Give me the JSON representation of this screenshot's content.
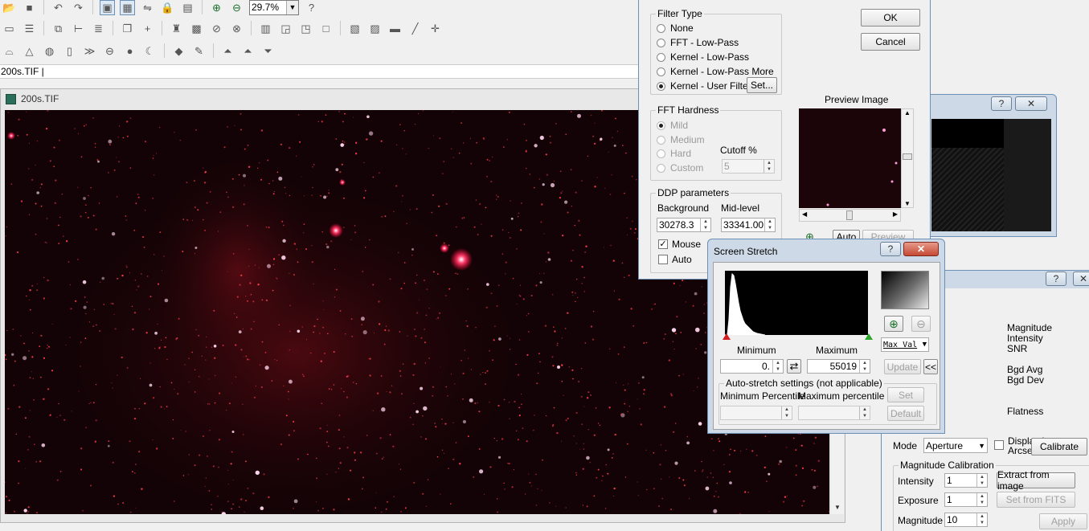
{
  "toolbar": {
    "zoom_value": "29.7%",
    "row1_icons": [
      "folder-open-icon",
      "save-icon",
      "undo-icon",
      "redo-icon",
      "image-view-icon",
      "grid-view-icon",
      "flip-icon",
      "lock-icon",
      "properties-icon",
      "zoom-in-icon",
      "zoom-out-icon"
    ],
    "row2_icons": [
      "ruler-icon",
      "layers-icon",
      "crop-icon",
      "align-icon",
      "list-icon",
      "add-icon",
      "brush-icon",
      "texture-icon",
      "no-entry-icon",
      "circle-slash-icon",
      "bar-graph-icon",
      "stack-icon",
      "stack2-icon",
      "square-icon",
      "image-icon",
      "image2-icon",
      "minus-box-icon",
      "line-icon",
      "star-plus-icon"
    ],
    "row3_icons": [
      "hat-icon",
      "triangle-icon",
      "globe-icon",
      "film-icon",
      "chevrons-icon",
      "dash-circle-icon",
      "sphere-icon",
      "crescent-icon",
      "shapes-icon",
      "pen-icon",
      "mountain-icon",
      "mountain2-icon",
      "flat-icon"
    ]
  },
  "path_bar": {
    "text": "200s.TIF |"
  },
  "image_window": {
    "title": "200s.TIF"
  },
  "ddp_dialog": {
    "ok": "OK",
    "cancel": "Cancel",
    "filter_type_label": "Filter Type",
    "filters": [
      "None",
      "FFT - Low-Pass",
      "Kernel - Low-Pass",
      "Kernel - Low-Pass More",
      "Kernel - User Filter"
    ],
    "selected_filter": 4,
    "set_button": "Set...",
    "fft_hardness_label": "FFT Hardness",
    "hardness": [
      "Mild",
      "Medium",
      "Hard",
      "Custom"
    ],
    "cutoff_label": "Cutoff %",
    "cutoff_value": "5",
    "ddp_params_label": "DDP parameters",
    "background_label": "Background",
    "background_value": "30278.3",
    "midlevel_label": "Mid-level",
    "midlevel_value": "33341.00",
    "mouse_label": "Mouse",
    "auto_label": "Auto",
    "preview_image_label": "Preview Image",
    "auto_button": "Auto",
    "preview_button": "Preview"
  },
  "screen_stretch": {
    "title": "Screen Stretch",
    "minimum_label": "Minimum",
    "maximum_label": "Maximum",
    "minimum_value": "0.",
    "maximum_value": "55019",
    "update_button": "Update",
    "collapse_button": "<<",
    "max_val_select": "Max Val",
    "autostretch_label": "Auto-stretch settings (not applicable)",
    "min_percentile_label": "Minimum Percentile",
    "max_percentile_label": "Maximum percentile",
    "set_button": "Set",
    "default_button": "Default"
  },
  "photometry_panel": {
    "labels": [
      "Magnitude",
      "Intensity",
      "SNR",
      "Bgd Avg",
      "Bgd Dev",
      "Flatness"
    ],
    "mode_label": "Mode",
    "mode_value": "Aperture",
    "display_arcsec": "Display in Arcsec",
    "calibrate_button": "Calibrate",
    "mag_cal_label": "Magnitude Calibration",
    "intensity_label": "Intensity",
    "intensity_value": "1",
    "exposure_label": "Exposure",
    "exposure_value": "1",
    "magnitude_label": "Magnitude",
    "magnitude_value": "10",
    "extract_button": "Extract from image",
    "fits_button": "Set from FITS",
    "apply_button": "Apply"
  },
  "caption_buttons": {
    "help": "?",
    "close": "✕"
  },
  "colors": {
    "sky": "#140306",
    "star_red": "#ff3b4e",
    "star_white": "#ffd6ee"
  }
}
